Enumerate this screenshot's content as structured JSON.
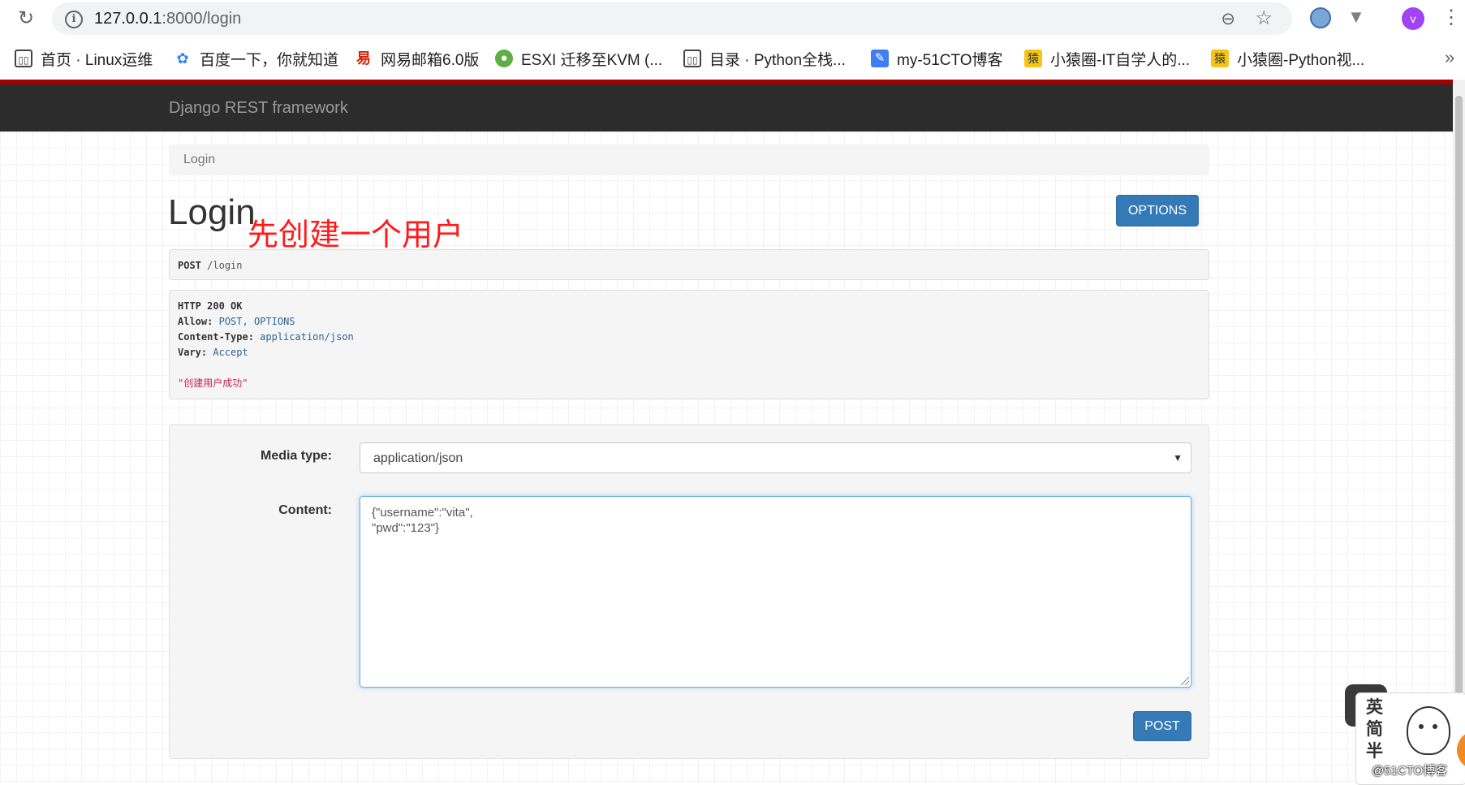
{
  "browser": {
    "url_host": "127.0.0.1",
    "url_rest": ":8000/login",
    "avatar_letter": "v",
    "bookmarks": [
      {
        "label": "首页 · Linux运维",
        "icon": "book-icon"
      },
      {
        "label": "百度一下，你就知道",
        "icon": "baidu-paw-icon"
      },
      {
        "label": "网易邮箱6.0版",
        "icon": "netease-mail-icon"
      },
      {
        "label": "ESXI 迁移至KVM (...",
        "icon": "frog-icon"
      },
      {
        "label": "目录 · Python全栈...",
        "icon": "book-icon"
      },
      {
        "label": "my-51CTO博客",
        "icon": "feather-icon"
      },
      {
        "label": "小猿圈-IT自学人的...",
        "icon": "yuan-icon"
      },
      {
        "label": "小猿圈-Python视...",
        "icon": "yuan-icon"
      }
    ],
    "more": "»"
  },
  "navbar": {
    "brand": "Django REST framework"
  },
  "breadcrumb": {
    "current": "Login"
  },
  "page": {
    "title": "Login",
    "annotation": "先创建一个用户",
    "options_label": "OPTIONS"
  },
  "request": {
    "method": "POST",
    "path": "/login"
  },
  "response": {
    "status": "HTTP 200 OK",
    "headers": [
      {
        "name": "Allow:",
        "value": "POST, OPTIONS"
      },
      {
        "name": "Content-Type:",
        "value": "application/json"
      },
      {
        "name": "Vary:",
        "value": "Accept"
      }
    ],
    "body": "\"创建用户成功\""
  },
  "form": {
    "media_type_label": "Media type:",
    "media_type_value": "application/json",
    "content_label": "Content:",
    "content_value": "{\"username\":\"vita\",\n\"pwd\":\"123\"}",
    "post_label": "POST"
  },
  "overlay": {
    "ime_chars": [
      "英",
      "简",
      "半"
    ],
    "watermark": "@51CTO博客"
  },
  "colors": {
    "primary": "#337ab7",
    "navbar": "#2c2c2c",
    "accent_line": "#a30000",
    "annotation": "#ff1a1a",
    "response_string": "#c7254e"
  }
}
